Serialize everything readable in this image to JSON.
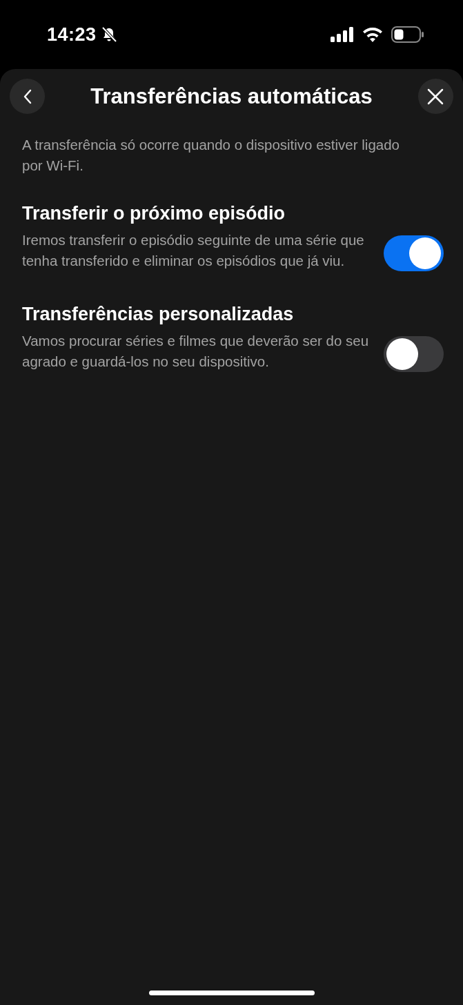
{
  "status_bar": {
    "time": "14:23"
  },
  "header": {
    "title": "Transferências automáticas"
  },
  "intro": "A transferência só ocorre quando o dispositivo estiver ligado por Wi-Fi.",
  "settings": [
    {
      "title": "Transferir o próximo episódio",
      "description": "Iremos transferir o episódio seguinte de uma série que tenha transferido e eliminar os episódios que já viu.",
      "on": true
    },
    {
      "title": "Transferências personalizadas",
      "description": "Vamos procurar séries e filmes que deverão ser do seu agrado e guardá-los no seu dispositivo.",
      "on": false
    }
  ]
}
